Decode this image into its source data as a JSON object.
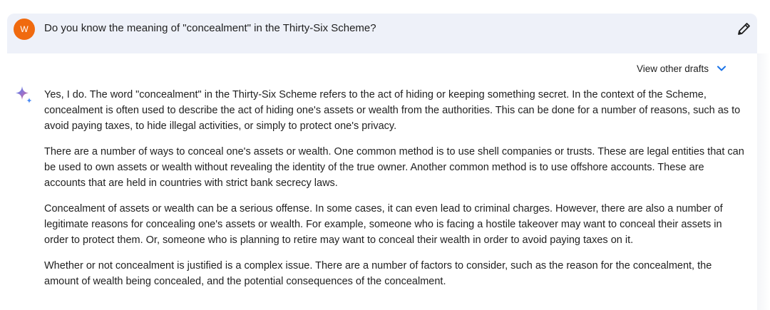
{
  "prompt": {
    "avatar_letter": "W",
    "avatar_color": "#f06a0f",
    "text": "Do you know the meaning of \"concealment\" in the Thirty-Six Scheme?",
    "edit_icon": "pencil-icon"
  },
  "response": {
    "drafts_label": "View other drafts",
    "drafts_icon": "chevron-down-icon",
    "assistant_icon": "sparkle-icon",
    "paragraphs": [
      "Yes, I do. The word \"concealment\" in the Thirty-Six Scheme refers to the act of hiding or keeping something secret. In the context of the Scheme, concealment is often used to describe the act of hiding one's assets or wealth from the authorities. This can be done for a number of reasons, such as to avoid paying taxes, to hide illegal activities, or simply to protect one's privacy.",
      "There are a number of ways to conceal one's assets or wealth. One common method is to use shell companies or trusts. These are legal entities that can be used to own assets or wealth without revealing the identity of the true owner. Another common method is to use offshore accounts. These are accounts that are held in countries with strict bank secrecy laws.",
      "Concealment of assets or wealth can be a serious offense. In some cases, it can even lead to criminal charges. However, there are also a number of legitimate reasons for concealing one's assets or wealth. For example, someone who is facing a hostile takeover may want to conceal their assets in order to protect them. Or, someone who is planning to retire may want to conceal their wealth in order to avoid paying taxes on it.",
      "Whether or not concealment is justified is a complex issue. There are a number of factors to consider, such as the reason for the concealment, the amount of wealth being concealed, and the potential consequences of the concealment."
    ]
  },
  "colors": {
    "prompt_background": "#eef1f9",
    "accent_blue": "#1a73e8",
    "text": "#1f1f1f"
  }
}
